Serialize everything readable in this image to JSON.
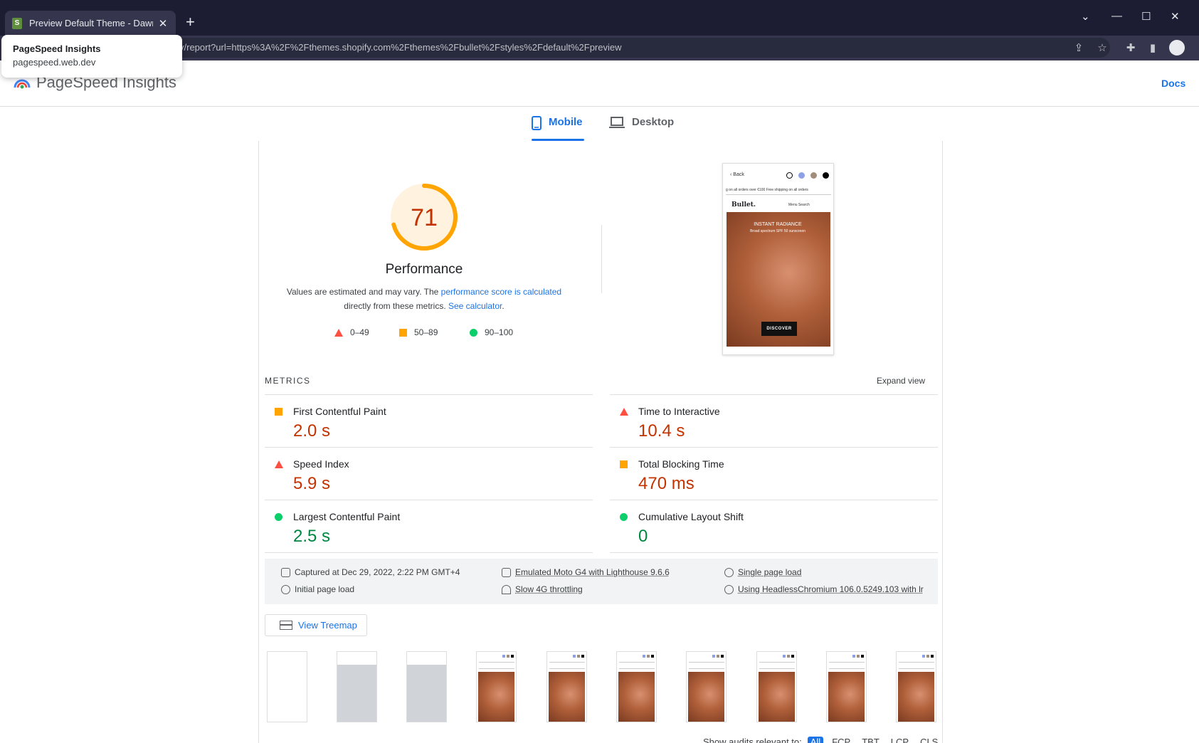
{
  "browser": {
    "tab_title": "Preview Default Theme - Dawn E",
    "url": "v/report?url=https%3A%2F%2Fthemes.shopify.com%2Fthemes%2Fbullet%2Fstyles%2Fdefault%2Fpreview",
    "popup": {
      "title": "PageSpeed Insights",
      "host": "pagespeed.web.dev"
    }
  },
  "header": {
    "app_name": "PageSpeed Insights",
    "docs_label": "Docs"
  },
  "tabs": {
    "mobile": "Mobile",
    "desktop": "Desktop"
  },
  "performance": {
    "score": "71",
    "score_value": 71,
    "score_color": "#ffa400",
    "title": "Performance",
    "desc_prefix": "Values are estimated and may vary. The ",
    "desc_link1": "performance score is calculated",
    "desc_middle": " directly from these metrics. ",
    "desc_link2": "See calculator",
    "desc_suffix": ".",
    "legend": {
      "fail": "0–49",
      "average": "50–89",
      "pass": "90–100"
    }
  },
  "screenshot": {
    "back": "Back",
    "banner": "g on all orders over €100     Free shipping on all orders",
    "brand": "Bullet.",
    "nav": "Menu   Search",
    "heading": "INSTANT RADIANCE",
    "sub": "Broad spectrum SPF 50 sunscreen",
    "button": "DISCOVER"
  },
  "metrics": {
    "heading": "METRICS",
    "expand_label": "Expand view",
    "items": [
      {
        "name": "First Contentful Paint",
        "value": "2.0 s",
        "rating": "average"
      },
      {
        "name": "Time to Interactive",
        "value": "10.4 s",
        "rating": "fail"
      },
      {
        "name": "Speed Index",
        "value": "5.9 s",
        "rating": "fail"
      },
      {
        "name": "Total Blocking Time",
        "value": "470 ms",
        "rating": "average"
      },
      {
        "name": "Largest Contentful Paint",
        "value": "2.5 s",
        "rating": "pass"
      },
      {
        "name": "Cumulative Layout Shift",
        "value": "0",
        "rating": "pass"
      }
    ]
  },
  "environment": {
    "captured": "Captured at Dec 29, 2022, 2:22 PM GMT+4",
    "initial_load": "Initial page load",
    "device": "Emulated Moto G4 with Lighthouse 9.6.6",
    "throttling": "Slow 4G throttling",
    "page_load": "Single page load",
    "browser": "Using HeadlessChromium 106.0.5249.103 with lr"
  },
  "treemap_label": "View Treemap",
  "audits": {
    "label": "Show audits relevant to:",
    "filters": [
      "All",
      "FCP",
      "TBT",
      "LCP",
      "CLS"
    ],
    "active": "All"
  },
  "colors": {
    "accent": "#1a73e8",
    "fail": "#ff4e42",
    "average": "#ffa400",
    "pass": "#0cce6b"
  }
}
